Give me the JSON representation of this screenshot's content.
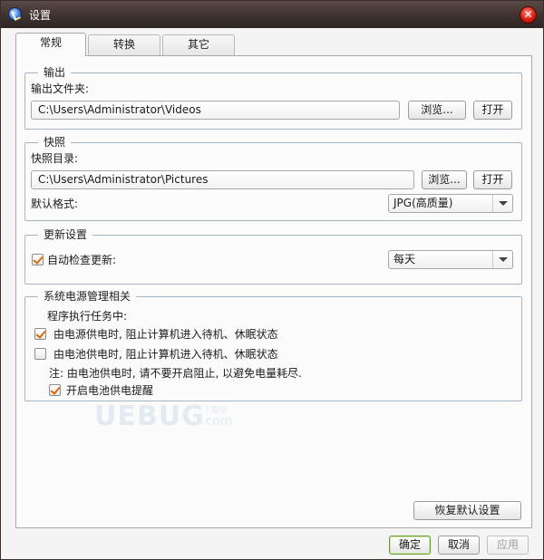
{
  "window": {
    "title": "设置"
  },
  "tabs": [
    {
      "label": "常规",
      "active": true
    },
    {
      "label": "转换",
      "active": false
    },
    {
      "label": "其它",
      "active": false
    }
  ],
  "output": {
    "title": "输出",
    "folder_label": "输出文件夹:",
    "folder_value": "C:\\Users\\Administrator\\Videos",
    "browse_label": "浏览...",
    "open_label": "打开"
  },
  "snapshot": {
    "title": "快照",
    "dir_label": "快照目录:",
    "dir_value": "C:\\Users\\Administrator\\Pictures",
    "browse_label": "浏览...",
    "open_label": "打开",
    "format_label": "默认格式:",
    "format_value": "JPG(高质量)"
  },
  "update": {
    "title": "更新设置",
    "auto_check_label": "自动检查更新:",
    "auto_check_checked": true,
    "frequency_value": "每天"
  },
  "power": {
    "title": "系统电源管理相关",
    "during_task_label": "程序执行任务中:",
    "ac_label": "由电源供电时, 阻止计算机进入待机、休眠状态",
    "ac_checked": true,
    "battery_label": "由电池供电时, 阻止计算机进入待机、休眠状态",
    "battery_checked": false,
    "note": "注: 由电池供电时, 请不要开启阻止, 以避免电量耗尽.",
    "battery_reminder_label": "开启电池供电提醒",
    "battery_reminder_checked": true
  },
  "watermark": {
    "main": "UEBUG",
    "sub": "下载站",
    "domain": ".com"
  },
  "restore_defaults_label": "恢复默认设置",
  "footer": {
    "ok_label": "确定",
    "cancel_label": "取消",
    "apply_label": "应用"
  },
  "icons": {
    "app": "app-logo-icon",
    "close": "close-icon",
    "dropdown": "chevron-down-icon",
    "check": "checkmark-icon"
  },
  "colors": {
    "titlebar": "#3e322e",
    "close": "#d81e10",
    "check": "#d86a0b",
    "group_border": "#a3b5c8"
  }
}
